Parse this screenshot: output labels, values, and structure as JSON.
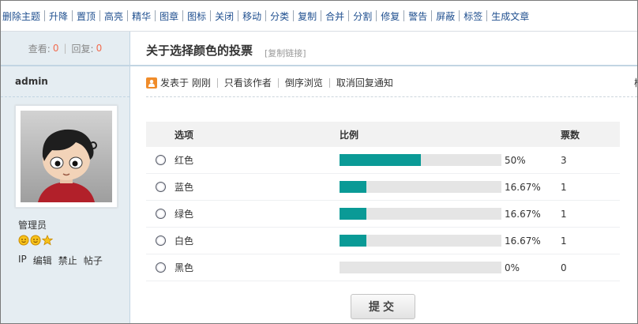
{
  "toolbar": {
    "items": [
      "删除主题",
      "升降",
      "置顶",
      "高亮",
      "精华",
      "图章",
      "图标",
      "关闭",
      "移动",
      "分类",
      "复制",
      "合并",
      "分割",
      "修复",
      "警告",
      "屏蔽",
      "标签",
      "生成文章"
    ]
  },
  "stats": {
    "views_label": "查看:",
    "views": "0",
    "replies_label": "回复:",
    "replies": "0"
  },
  "author": {
    "name": "admin",
    "group": "管理员",
    "links": [
      "IP",
      "编辑",
      "禁止",
      "帖子"
    ],
    "stars": [
      "sun-icon",
      "sun-icon",
      "star-icon"
    ]
  },
  "thread": {
    "title": "关于选择颜色的投票",
    "copy_link": "[复制链接]"
  },
  "post_info": {
    "posted": "发表于 刚刚",
    "only_author": "只看该作者",
    "reverse": "倒序浏览",
    "cancel_notify": "取消回复通知",
    "edge_text": "楼"
  },
  "poll": {
    "headers": {
      "option": "选项",
      "ratio": "比例",
      "votes": "票数"
    },
    "accent": "#0a9a96",
    "options": [
      {
        "label": "红色",
        "percent_text": "50%",
        "percent": 50,
        "votes": "3"
      },
      {
        "label": "蓝色",
        "percent_text": "16.67%",
        "percent": 16.67,
        "votes": "1"
      },
      {
        "label": "绿色",
        "percent_text": "16.67%",
        "percent": 16.67,
        "votes": "1"
      },
      {
        "label": "白色",
        "percent_text": "16.67%",
        "percent": 16.67,
        "votes": "1"
      },
      {
        "label": "黑色",
        "percent_text": "0%",
        "percent": 0,
        "votes": "0"
      }
    ],
    "submit_label": "提交"
  }
}
